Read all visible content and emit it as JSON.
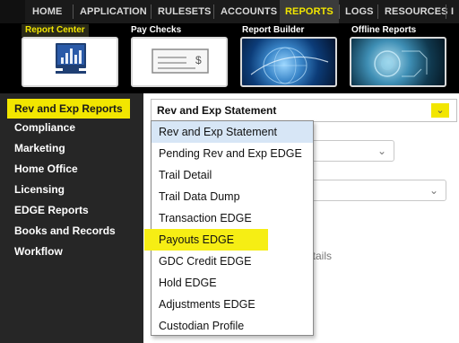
{
  "topnav": {
    "items": [
      "HOME",
      "APPLICATION",
      "RULESETS",
      "ACCOUNTS",
      "REPORTS",
      "LOGS",
      "RESOURCES",
      "I"
    ],
    "active": "REPORTS"
  },
  "tiles": [
    {
      "label": "Report Center",
      "icon": "monitor-chart-icon"
    },
    {
      "label": "Pay Checks",
      "icon": "check-icon"
    },
    {
      "label": "Report Builder",
      "icon": "globe-image"
    },
    {
      "label": "Offline Reports",
      "icon": "tech-image"
    }
  ],
  "sidebar": {
    "items": [
      {
        "label": "Rev and Exp Reports"
      },
      {
        "label": "Compliance"
      },
      {
        "label": "Marketing"
      },
      {
        "label": "Home Office"
      },
      {
        "label": "Licensing"
      },
      {
        "label": "EDGE Reports"
      },
      {
        "label": "Books and Records"
      },
      {
        "label": "Workflow"
      }
    ]
  },
  "main": {
    "report_select": {
      "value": "Rev and Exp Statement"
    },
    "ghost_text_1": "etails",
    "ghost_text_2": "s"
  },
  "dropdown": {
    "options": [
      "Rev and Exp Statement",
      "Pending Rev and Exp EDGE",
      "Trail Detail",
      "Trail Data Dump",
      "Transaction EDGE",
      "Payouts EDGE",
      "GDC Credit EDGE",
      "Hold EDGE",
      "Adjustments EDGE",
      "Custodian Profile"
    ]
  },
  "colors": {
    "accent_yellow": "#f2e600",
    "nav_bg": "#1a1a1a",
    "sidebar_bg": "#262626",
    "selected_option_bg": "#d7e6f6"
  }
}
